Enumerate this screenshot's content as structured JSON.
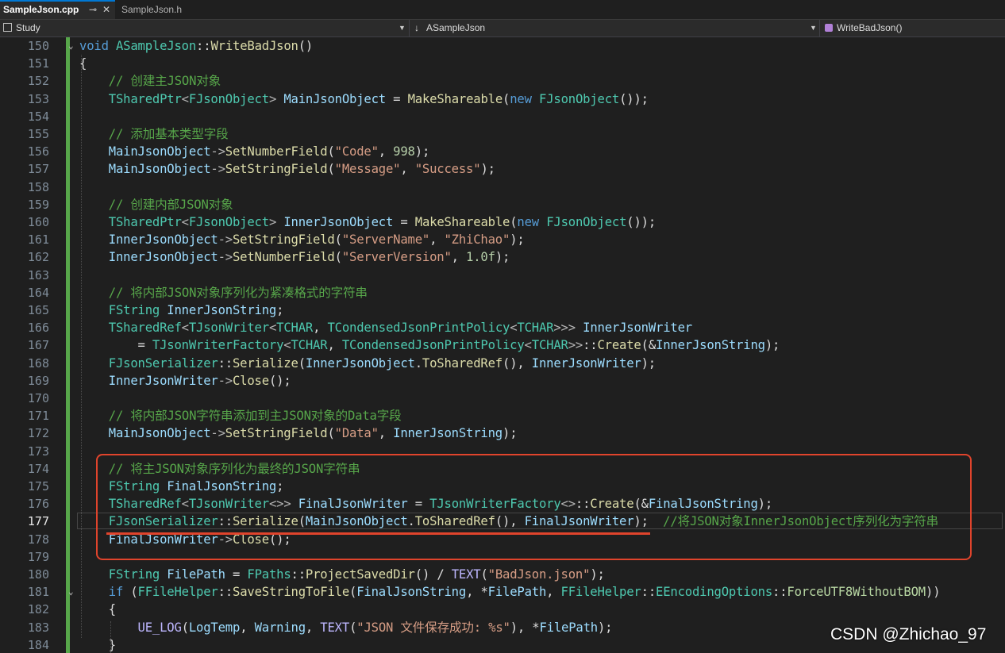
{
  "tabs": [
    {
      "label": "SampleJson.cpp",
      "pin": "⊸",
      "close": "✕"
    },
    {
      "label": "SampleJson.h"
    }
  ],
  "nav": {
    "project": "Study",
    "class": "ASampleJson",
    "member": "WriteBadJson()"
  },
  "lines": [
    {
      "n": "150",
      "html": "<span class=\"kw\">void</span> <span class=\"ty\">ASampleJson</span>::<span class=\"fn\">WriteBadJson</span>()"
    },
    {
      "n": "151",
      "html": "{"
    },
    {
      "n": "152",
      "html": "    <span class=\"cm\">// 创建主JSON对象</span>"
    },
    {
      "n": "153",
      "html": "    <span class=\"ty\">TSharedPtr</span><span class=\"op\">&lt;</span><span class=\"ty\">FJsonObject</span><span class=\"op\">&gt;</span> <span class=\"vr\">MainJsonObject</span> = <span class=\"fn\">MakeShareable</span>(<span class=\"kw\">new</span> <span class=\"ty\">FJsonObject</span>());"
    },
    {
      "n": "154",
      "html": ""
    },
    {
      "n": "155",
      "html": "    <span class=\"cm\">// 添加基本类型字段</span>"
    },
    {
      "n": "156",
      "html": "    <span class=\"vr\">MainJsonObject</span><span class=\"op\">-&gt;</span><span class=\"fn\">SetNumberField</span>(<span class=\"st\">\"Code\"</span>, <span class=\"nm\">998</span>);"
    },
    {
      "n": "157",
      "html": "    <span class=\"vr\">MainJsonObject</span><span class=\"op\">-&gt;</span><span class=\"fn\">SetStringField</span>(<span class=\"st\">\"Message\"</span>, <span class=\"st\">\"Success\"</span>);"
    },
    {
      "n": "158",
      "html": ""
    },
    {
      "n": "159",
      "html": "    <span class=\"cm\">// 创建内部JSON对象</span>"
    },
    {
      "n": "160",
      "html": "    <span class=\"ty\">TSharedPtr</span><span class=\"op\">&lt;</span><span class=\"ty\">FJsonObject</span><span class=\"op\">&gt;</span> <span class=\"vr\">InnerJsonObject</span> = <span class=\"fn\">MakeShareable</span>(<span class=\"kw\">new</span> <span class=\"ty\">FJsonObject</span>());"
    },
    {
      "n": "161",
      "html": "    <span class=\"vr\">InnerJsonObject</span><span class=\"op\">-&gt;</span><span class=\"fn\">SetStringField</span>(<span class=\"st\">\"ServerName\"</span>, <span class=\"st\">\"ZhiChao\"</span>);"
    },
    {
      "n": "162",
      "html": "    <span class=\"vr\">InnerJsonObject</span><span class=\"op\">-&gt;</span><span class=\"fn\">SetNumberField</span>(<span class=\"st\">\"ServerVersion\"</span>, <span class=\"nm\">1.0f</span>);"
    },
    {
      "n": "163",
      "html": ""
    },
    {
      "n": "164",
      "html": "    <span class=\"cm\">// 将内部JSON对象序列化为紧凑格式的字符串</span>"
    },
    {
      "n": "165",
      "html": "    <span class=\"ty\">FString</span> <span class=\"vr\">InnerJsonString</span>;"
    },
    {
      "n": "166",
      "html": "    <span class=\"ty\">TSharedRef</span><span class=\"op\">&lt;</span><span class=\"ty\">TJsonWriter</span><span class=\"op\">&lt;</span><span class=\"ty\">TCHAR</span>, <span class=\"ty\">TCondensedJsonPrintPolicy</span><span class=\"op\">&lt;</span><span class=\"ty\">TCHAR</span><span class=\"op\">&gt;&gt;&gt;</span> <span class=\"vr\">InnerJsonWriter</span>"
    },
    {
      "n": "167",
      "html": "        = <span class=\"ty\">TJsonWriterFactory</span><span class=\"op\">&lt;</span><span class=\"ty\">TCHAR</span>, <span class=\"ty\">TCondensedJsonPrintPolicy</span><span class=\"op\">&lt;</span><span class=\"ty\">TCHAR</span><span class=\"op\">&gt;&gt;</span>::<span class=\"fn\">Create</span>(&amp;<span class=\"vr\">InnerJsonString</span>);"
    },
    {
      "n": "168",
      "html": "    <span class=\"ty\">FJsonSerializer</span>::<span class=\"fn\">Serialize</span>(<span class=\"vr\">InnerJsonObject</span>.<span class=\"fn\">ToSharedRef</span>(), <span class=\"vr\">InnerJsonWriter</span>);"
    },
    {
      "n": "169",
      "html": "    <span class=\"vr\">InnerJsonWriter</span><span class=\"op\">-&gt;</span><span class=\"fn\">Close</span>();"
    },
    {
      "n": "170",
      "html": ""
    },
    {
      "n": "171",
      "html": "    <span class=\"cm\">// 将内部JSON字符串添加到主JSON对象的Data字段</span>"
    },
    {
      "n": "172",
      "html": "    <span class=\"vr\">MainJsonObject</span><span class=\"op\">-&gt;</span><span class=\"fn\">SetStringField</span>(<span class=\"st\">\"Data\"</span>, <span class=\"vr\">InnerJsonString</span>);"
    },
    {
      "n": "173",
      "html": ""
    },
    {
      "n": "174",
      "html": "    <span class=\"cm\">// 将主JSON对象序列化为最终的JSON字符串</span>"
    },
    {
      "n": "175",
      "html": "    <span class=\"ty\">FString</span> <span class=\"vr\">FinalJsonString</span>;"
    },
    {
      "n": "176",
      "html": "    <span class=\"ty\">TSharedRef</span><span class=\"op\">&lt;</span><span class=\"ty\">TJsonWriter</span><span class=\"op\">&lt;&gt;&gt;</span> <span class=\"vr\">FinalJsonWriter</span> = <span class=\"ty\">TJsonWriterFactory</span><span class=\"op\">&lt;&gt;</span>::<span class=\"fn\">Create</span>(&amp;<span class=\"vr\">FinalJsonString</span>);"
    },
    {
      "n": "177",
      "html": "    <span class=\"ty\">FJsonSerializer</span>::<span class=\"fn\">Serialize</span>(<span class=\"vr\">MainJsonObject</span>.<span class=\"fn\">ToSharedRef</span>(), <span class=\"vr\">FinalJsonWriter</span>);  <span class=\"cm\">//将JSON对象InnerJsonObject序列化为字符串</span>"
    },
    {
      "n": "178",
      "html": "    <span class=\"vr\">FinalJsonWriter</span><span class=\"op\">-&gt;</span><span class=\"fn\">Close</span>();"
    },
    {
      "n": "179",
      "html": ""
    },
    {
      "n": "180",
      "html": "    <span class=\"ty\">FString</span> <span class=\"vr\">FilePath</span> = <span class=\"ty\">FPaths</span>::<span class=\"fn\">ProjectSavedDir</span>() / <span class=\"mc\">TEXT</span>(<span class=\"st\">\"BadJson.json\"</span>);"
    },
    {
      "n": "181",
      "html": "    <span class=\"kw\">if</span> (<span class=\"ty\">FFileHelper</span>::<span class=\"fn\">SaveStringToFile</span>(<span class=\"vr\">FinalJsonString</span>, *<span class=\"vr\">FilePath</span>, <span class=\"ty\">FFileHelper</span>::<span class=\"ty\">EEncodingOptions</span>::<span class=\"en\">ForceUTF8WithoutBOM</span>))"
    },
    {
      "n": "182",
      "html": "    {"
    },
    {
      "n": "183",
      "html": "        <span class=\"mc\">UE_LOG</span>(<span class=\"vr\">LogTemp</span>, <span class=\"vr\">Warning</span>, <span class=\"mc\">TEXT</span>(<span class=\"st\">\"JSON 文件保存成功: %s\"</span>), *<span class=\"vr\">FilePath</span>);"
    },
    {
      "n": "184",
      "html": "    }"
    }
  ],
  "current_line": "177",
  "watermark": "CSDN @Zhichao_97",
  "colors": {
    "keyword": "#569cd6",
    "type": "#4ec9b0",
    "function": "#dcdcaa",
    "variable": "#9cdcfe",
    "string": "#d69d85",
    "comment": "#57a64a",
    "annotation": "#e0442c"
  }
}
